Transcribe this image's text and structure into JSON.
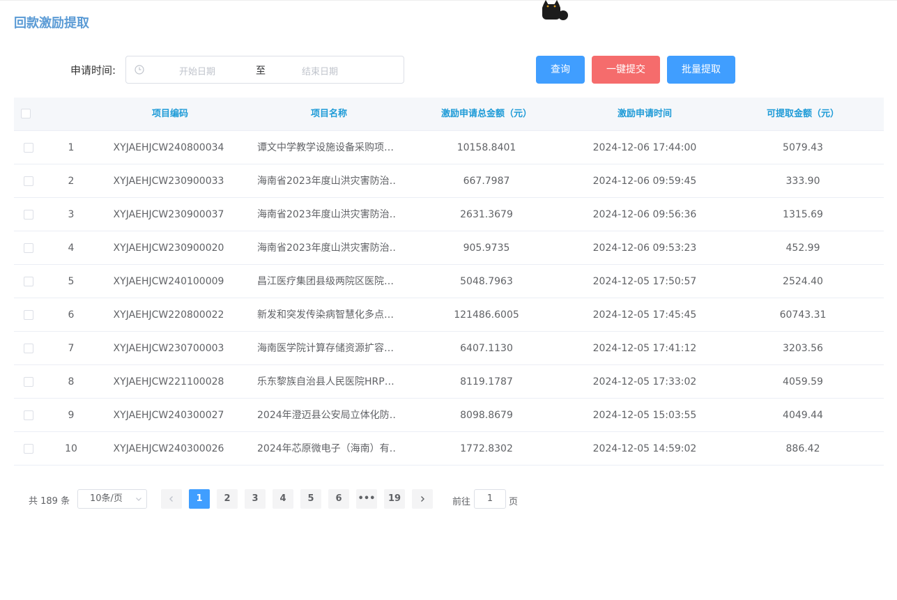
{
  "page": {
    "title": "回款激励提取"
  },
  "filter": {
    "label": "申请时间:",
    "start_placeholder": "开始日期",
    "separator": "至",
    "end_placeholder": "结束日期"
  },
  "buttons": {
    "query": "查询",
    "submit_all": "一键提交",
    "batch_extract": "批量提取"
  },
  "table": {
    "headers": [
      "项目编码",
      "项目名称",
      "激励申请总金额（元）",
      "激励申请时间",
      "可提取金额（元）"
    ],
    "rows": [
      {
        "idx": "1",
        "code": "XYJAEHJCW240800034",
        "name": "谭文中学教学设施设备采购项…",
        "total": "10158.8401",
        "time": "2024-12-06 17:44:00",
        "avail": "5079.43"
      },
      {
        "idx": "2",
        "code": "XYJAEHJCW230900033",
        "name": "海南省2023年度山洪灾害防治…",
        "total": "667.7987",
        "time": "2024-12-06 09:59:45",
        "avail": "333.90"
      },
      {
        "idx": "3",
        "code": "XYJAEHJCW230900037",
        "name": "海南省2023年度山洪灾害防治…",
        "total": "2631.3679",
        "time": "2024-12-06 09:56:36",
        "avail": "1315.69"
      },
      {
        "idx": "4",
        "code": "XYJAEHJCW230900020",
        "name": "海南省2023年度山洪灾害防治…",
        "total": "905.9735",
        "time": "2024-12-06 09:53:23",
        "avail": "452.99"
      },
      {
        "idx": "5",
        "code": "XYJAEHJCW240100009",
        "name": "昌江医疗集团县级两院区医院…",
        "total": "5048.7963",
        "time": "2024-12-05 17:50:57",
        "avail": "2524.40"
      },
      {
        "idx": "6",
        "code": "XYJAEHJCW220800022",
        "name": "新发和突发传染病智慧化多点…",
        "total": "121486.6005",
        "time": "2024-12-05 17:45:45",
        "avail": "60743.31"
      },
      {
        "idx": "7",
        "code": "XYJAEHJCW230700003",
        "name": "海南医学院计算存储资源扩容…",
        "total": "6407.1130",
        "time": "2024-12-05 17:41:12",
        "avail": "3203.56"
      },
      {
        "idx": "8",
        "code": "XYJAEHJCW221100028",
        "name": "乐东黎族自治县人民医院HRP…",
        "total": "8119.1787",
        "time": "2024-12-05 17:33:02",
        "avail": "4059.59"
      },
      {
        "idx": "9",
        "code": "XYJAEHJCW240300027",
        "name": "2024年澄迈县公安局立体化防…",
        "total": "8098.8679",
        "time": "2024-12-05 15:03:55",
        "avail": "4049.44"
      },
      {
        "idx": "10",
        "code": "XYJAEHJCW240300026",
        "name": "2024年芯原微电子（海南）有…",
        "total": "1772.8302",
        "time": "2024-12-05 14:59:02",
        "avail": "886.42"
      }
    ]
  },
  "pagination": {
    "total_text": "共 189 条",
    "page_size": "10条/页",
    "pages": [
      "1",
      "2",
      "3",
      "4",
      "5",
      "6",
      "•••",
      "19"
    ],
    "current": "1",
    "goto_label": "前往",
    "goto_value": "1",
    "page_unit": "页"
  },
  "colors": {
    "primary": "#409eff",
    "danger": "#f56c6c",
    "header_text": "#1e9bd7",
    "title": "#5b9bd5"
  }
}
